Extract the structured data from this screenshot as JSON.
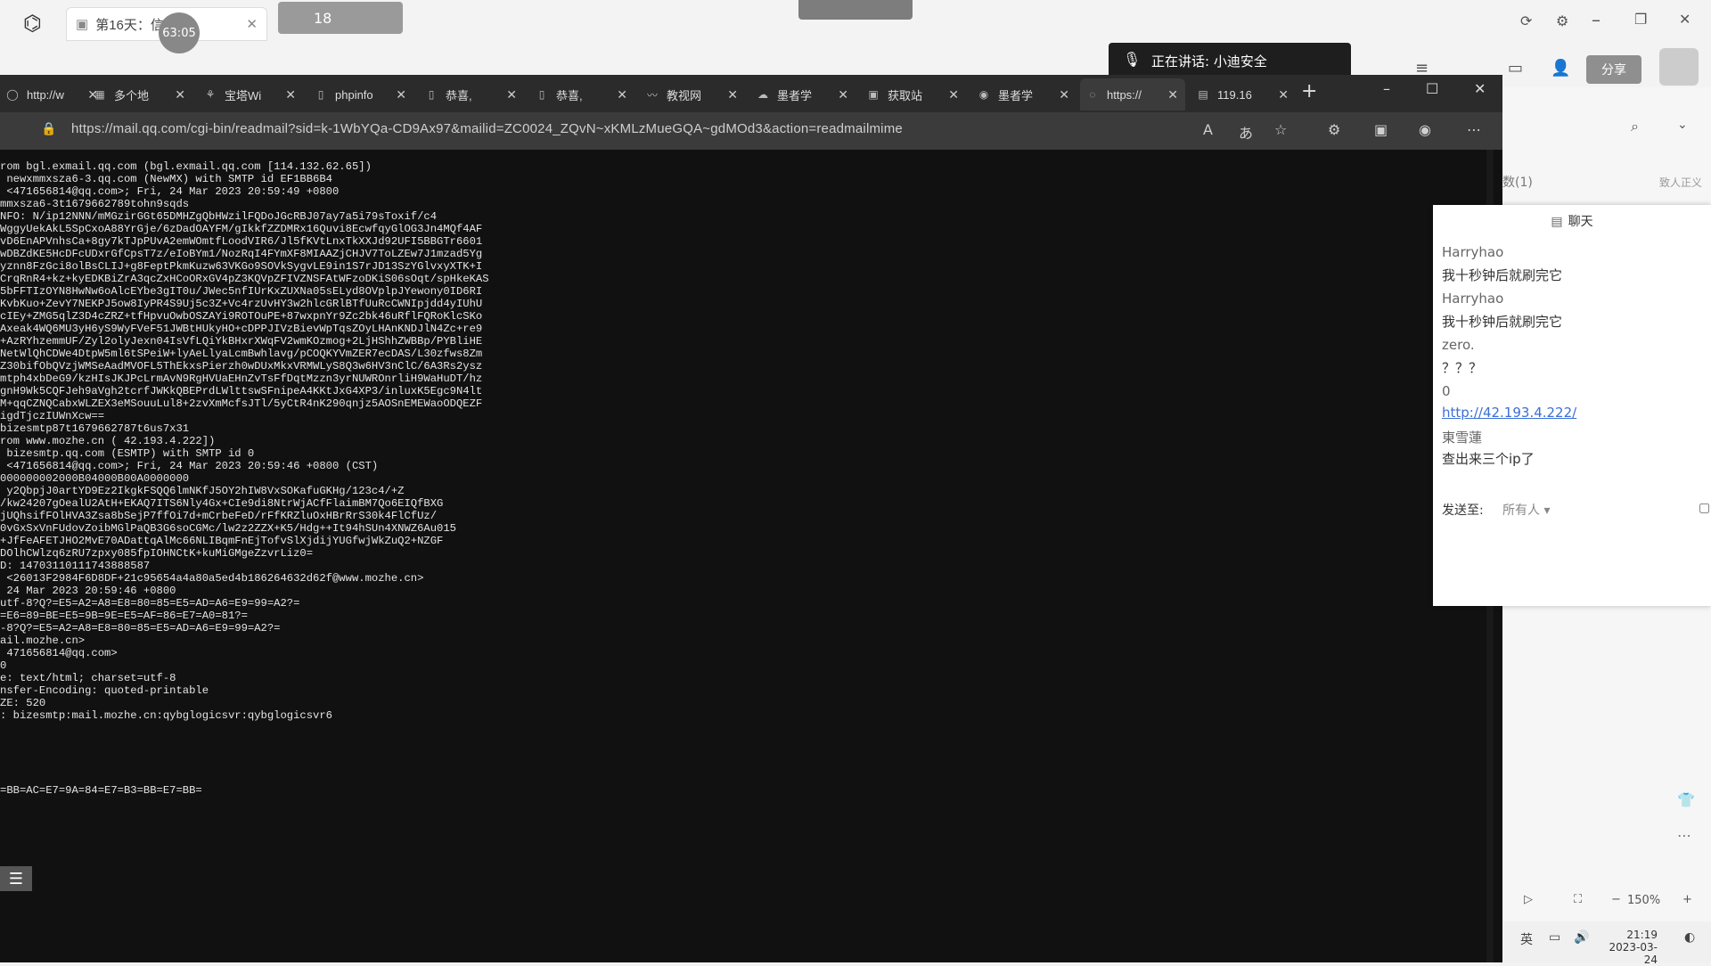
{
  "outer": {
    "tab_title": "第16天：信",
    "tab_badge": "63:05",
    "weather_temp": "18",
    "speaking_label": "正在讲话: 小迪安全",
    "share_label": "分享",
    "side_count": "数(1)",
    "side_right": "致人正义"
  },
  "browser": {
    "tabs": [
      {
        "label": "http://w",
        "icon": "globe-icon"
      },
      {
        "label": "多个地",
        "icon": "image-icon"
      },
      {
        "label": "宝塔Wi",
        "icon": "baota-icon"
      },
      {
        "label": "phpinfo",
        "icon": "doc-icon"
      },
      {
        "label": "恭喜, ",
        "icon": "doc-icon"
      },
      {
        "label": "恭喜, ",
        "icon": "doc-icon"
      },
      {
        "label": "教视网",
        "icon": "wave-icon"
      },
      {
        "label": "墨者学",
        "icon": "cloud-icon"
      },
      {
        "label": "获取站",
        "icon": "ip-icon"
      },
      {
        "label": "墨者学",
        "icon": "cloud-icon"
      },
      {
        "label": "https://",
        "icon": "loading-icon"
      },
      {
        "label": "119.16",
        "icon": "grid-icon"
      }
    ],
    "url": "https://mail.qq.com/cgi-bin/readmail?sid=k-1WbYQa-CD9Ax97&mailid=ZC0024_ZQvN~xKMLzMueGQA~gdMOd3&action=readmailmime"
  },
  "mail_lines": [
    "rom bgl.exmail.qq.com (bgl.exmail.qq.com [114.132.62.65])",
    " newxmmxsza6-3.qq.com (NewMX) with SMTP id EF1BB6B4",
    " <471656814@qq.com>; Fri, 24 Mar 2023 20:59:49 +0800",
    "mmxsza6-3t1679662789tohn9sqds",
    "NFO: N/ip12NNN/mMGzirGGt65DMHZgQbHWzilFQDoJGcRBJ07ay7a5i79sToxif/c4",
    "WggyUekAkL5SpCxoA88YrGje/6zDadOAYFM/gIkkfZZDMRx16Quvi8EcwfqyGlOG3Jn4MQf4AF",
    "vD6EnAPVnhsCa+8gy7kTJpPUvA2emWOmtfLoodVIR6/Jl5fKVtLnxTkXXJd92UFI5BBGTr6601",
    "wDBZdKE5HcDFcUDxrGfCpsT7z/eIoBYm1/NozRqI4FYmXF8MIAAZjCHJV7ToLZEw7J1mzad5Yg",
    "yznn8FzGci8olBsCLIJ+g8FeptPkmKuzw63VKGo9SOVkSygvLE9in1S7rJD13SzYGlvxyXTK+I",
    "CrqRnR4+kz+kyEDKBiZrA3qcZxHCoORxGV4pZ3KQVpZFIVZNSFAtWFzoDKiS06sOqt/spHkeKAS",
    "5bFFTIzOYN8HwNw6oAlcEYbe3gIT0u/JWec5nfIUrKxZUXNa05sELyd8OVplpJYewony0ID6RI",
    "KvbKuo+ZevY7NEKPJ5ow8IyPR4S9Uj5c3Z+Vc4rzUvHY3w2hlcGRlBTfUuRcCWNIpjdd4yIUhU",
    "cIEy+ZMG5qlZ3D4cZRZ+tfHpvuOwbOSZAYi9ROTOuPE+87wxpnYr9Zc2bk46uRflFQRoKlcSKo",
    "Axeak4WQ6MU3yH6yS9WyFVeF51JWBtHUkyHO+cDPPJIVzBievWpTqsZOyLHAnKNDJlN4Zc+re9",
    "+AzRYhzemmUF/Zyl2olyJexn04IsVfLQiYkBHxrXWqFV2wmKOzmog+2LjHShhZWBBp/PYBliHE",
    "NetWlQhCDWe4DtpW5ml6tSPeiW+lyAeLlyaLcmBwhlavg/pCOQKYVmZER7ecDAS/L30zfws8Zm",
    "Z30bifObQVzjWMSeAadMVOFL5ThEkxsPierzh0wDUxMkxVRMWLyS8Q3w6HV3nClC/6A3Rs2ysz",
    "mtph4xbDeG9/kzHIsJKJPcLrmAvN9RgHVUaEHnZvTsFfDqtMzzn3yrNUWROnrliH9WaHuDT/hz",
    "gnH9Wk5CQFJeh9aVgh2tcrfJWKkQBEPrdLWlttswSFnipeA4KKtJxG4XP3/inluxK5Egc9N4lt",
    "M+qqCZNQCabxWLZEX3eMSouuLul8+2zvXmMcfsJTl/5yCtR4nK290qnjz5AOSnEMEWaoODQEZF",
    "igdTjczIUWnXcw==",
    "bizesmtp87t1679662787t6us7x31",
    "rom www.mozhe.cn ( 42.193.4.222])",
    " bizesmtp.qq.com (ESMTP) with SMTP id 0",
    " <471656814@qq.com>; Fri, 24 Mar 2023 20:59:46 +0800 (CST)",
    "000000002000B04000B00A0000000",
    " y2QbpjJ0artYD9Ez2IkgkFSQQ6lmNKfJ5OY2hIW8VxSOKafuGKHg/123c4/+Z",
    "/kw24207gOealU2AtH+EKAQ7ITS6Nly4Gx+CIe9di8NtrWjACfFlaimBM7Qo6EIQfBXG",
    "jUQhsifFOlHVA3Zsa8bSejP7ffOi7d+mCrbeFeD/rFfKRZluOxHBrRrS30k4FlCfUz/",
    "0vGxSxVnFUdovZoibMGlPaQB3G6soCGMc/lw2z2ZZX+K5/Hdg++It94hSUn4XNWZ6Au015",
    "+JfFeAFETJHO2MvE70ADattqAlMc66NLIBqmFnEjTofvSlXjdijYUGfwjWkZuQ2+NZGF",
    "DOlhCWlzq6zRU7zpxy085fpIOHNCtK+kuMiGMgeZzvrLiz0=",
    "D: 14703110111743888587",
    " <26013F2984F6D8DF+21c95654a4a80a5ed4b186264632d62f@www.mozhe.cn>",
    " 24 Mar 2023 20:59:46 +0800",
    "utf-8?Q?=E5=A2=A8=E8=80=85=E5=AD=A6=E9=99=A2?=",
    "=E6=89=BE=E5=9B=9E=E5=AF=86=E7=A0=81?=",
    "-8?Q?=E5=A2=A8=E8=80=85=E5=AD=A6=E9=99=A2?=",
    "ail.mozhe.cn>",
    " 471656814@qq.com>",
    "0",
    "e: text/html; charset=utf-8",
    "nsfer-Encoding: quoted-printable",
    "ZE: 520",
    ": bizesmtp:mail.mozhe.cn:qybglogicsvr:qybglogicsvr6",
    "",
    "",
    "",
    "",
    "",
    "=BB=AC=E7=9A=84=E7=B3=BB=E7=BB="
  ],
  "chat": {
    "title": "聊天",
    "messages": [
      {
        "name": "Harryhao",
        "text": "我十秒钟后就刷完它"
      },
      {
        "name": "Harryhao",
        "text": "我十秒钟后就刷完它"
      },
      {
        "name": "zero.",
        "text": "？？？"
      },
      {
        "name": "0",
        "text": "http://42.193.4.222/"
      },
      {
        "name": "東雪蓮",
        "text": "查出来三个ip了"
      }
    ],
    "send_to_label": "发送至:",
    "send_to_value": "所有人"
  },
  "bottom": {
    "zoom": "150%",
    "ime": "英",
    "time": "21:19",
    "date": "2023-03-24"
  }
}
